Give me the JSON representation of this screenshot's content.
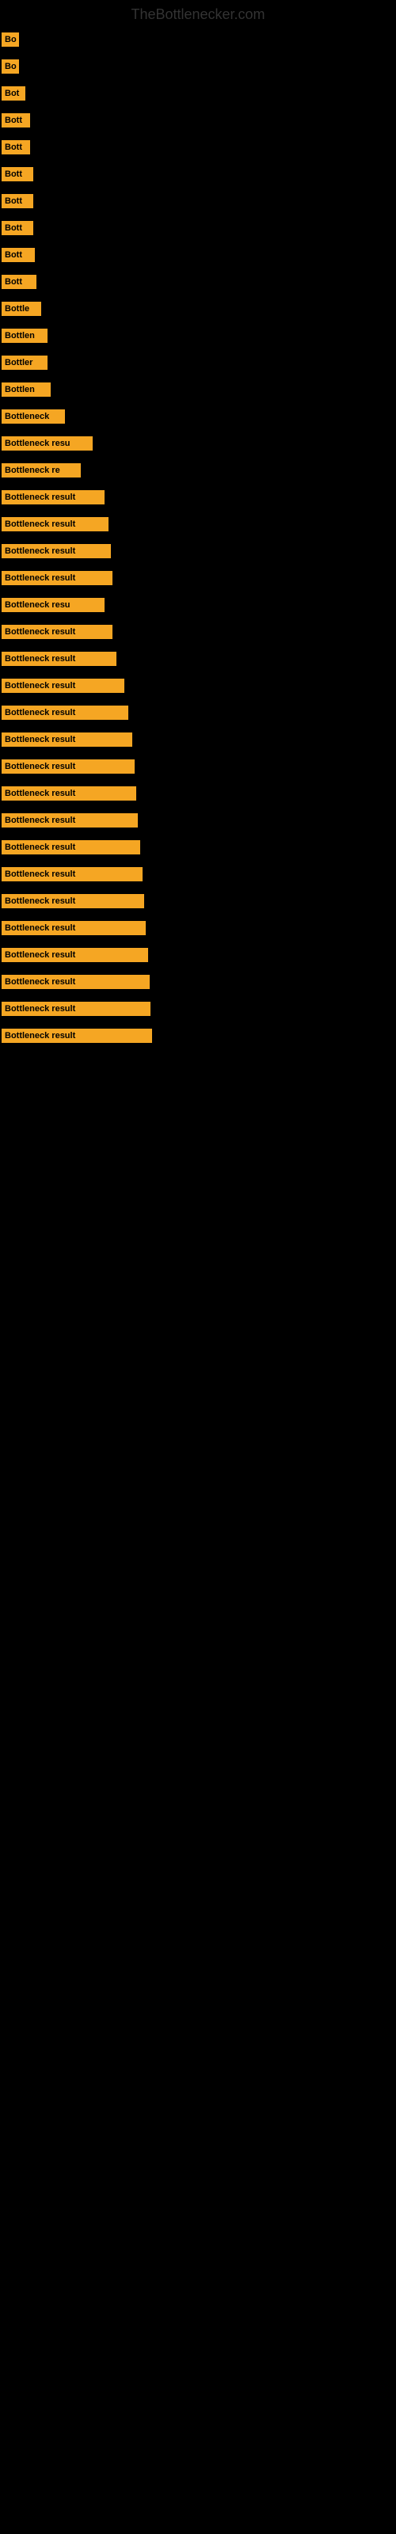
{
  "site_title": "TheBottlenecker.com",
  "bars": [
    {
      "label": "Bo",
      "width": 22
    },
    {
      "label": "Bo",
      "width": 22
    },
    {
      "label": "Bot",
      "width": 30
    },
    {
      "label": "Bott",
      "width": 36
    },
    {
      "label": "Bott",
      "width": 36
    },
    {
      "label": "Bott",
      "width": 40
    },
    {
      "label": "Bott",
      "width": 40
    },
    {
      "label": "Bott",
      "width": 40
    },
    {
      "label": "Bott",
      "width": 42
    },
    {
      "label": "Bott",
      "width": 44
    },
    {
      "label": "Bottle",
      "width": 50
    },
    {
      "label": "Bottlen",
      "width": 58
    },
    {
      "label": "Bottler",
      "width": 58
    },
    {
      "label": "Bottlen",
      "width": 62
    },
    {
      "label": "Bottleneck",
      "width": 80
    },
    {
      "label": "Bottleneck resu",
      "width": 115
    },
    {
      "label": "Bottleneck re",
      "width": 100
    },
    {
      "label": "Bottleneck result",
      "width": 130
    },
    {
      "label": "Bottleneck result",
      "width": 135
    },
    {
      "label": "Bottleneck result",
      "width": 138
    },
    {
      "label": "Bottleneck result",
      "width": 140
    },
    {
      "label": "Bottleneck resu",
      "width": 130
    },
    {
      "label": "Bottleneck result",
      "width": 140
    },
    {
      "label": "Bottleneck result",
      "width": 145
    },
    {
      "label": "Bottleneck result",
      "width": 155
    },
    {
      "label": "Bottleneck result",
      "width": 160
    },
    {
      "label": "Bottleneck result",
      "width": 165
    },
    {
      "label": "Bottleneck result",
      "width": 168
    },
    {
      "label": "Bottleneck result",
      "width": 170
    },
    {
      "label": "Bottleneck result",
      "width": 172
    },
    {
      "label": "Bottleneck result",
      "width": 175
    },
    {
      "label": "Bottleneck result",
      "width": 178
    },
    {
      "label": "Bottleneck result",
      "width": 180
    },
    {
      "label": "Bottleneck result",
      "width": 182
    },
    {
      "label": "Bottleneck result",
      "width": 185
    },
    {
      "label": "Bottleneck result",
      "width": 187
    },
    {
      "label": "Bottleneck result",
      "width": 188
    },
    {
      "label": "Bottleneck result",
      "width": 190
    }
  ]
}
